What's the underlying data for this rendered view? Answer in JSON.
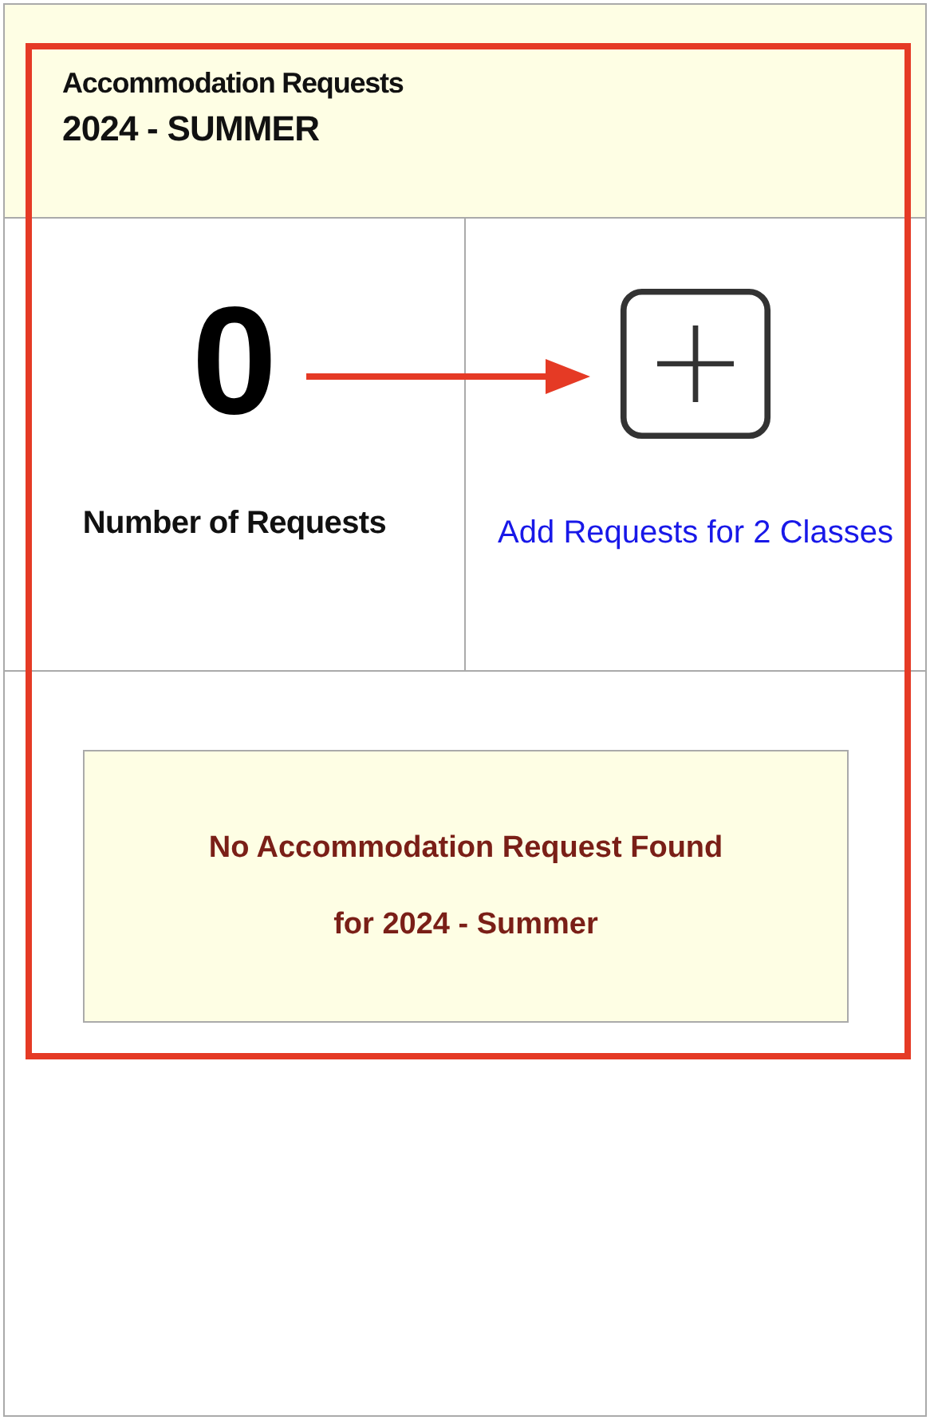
{
  "header": {
    "title": "Accommodation Requests",
    "term": "2024 - SUMMER"
  },
  "count": {
    "value": "0",
    "label": "Number of Requests"
  },
  "add": {
    "link": "Add Requests for 2 Classes"
  },
  "message": "No Accommodation Request Found for 2024 - Summer"
}
